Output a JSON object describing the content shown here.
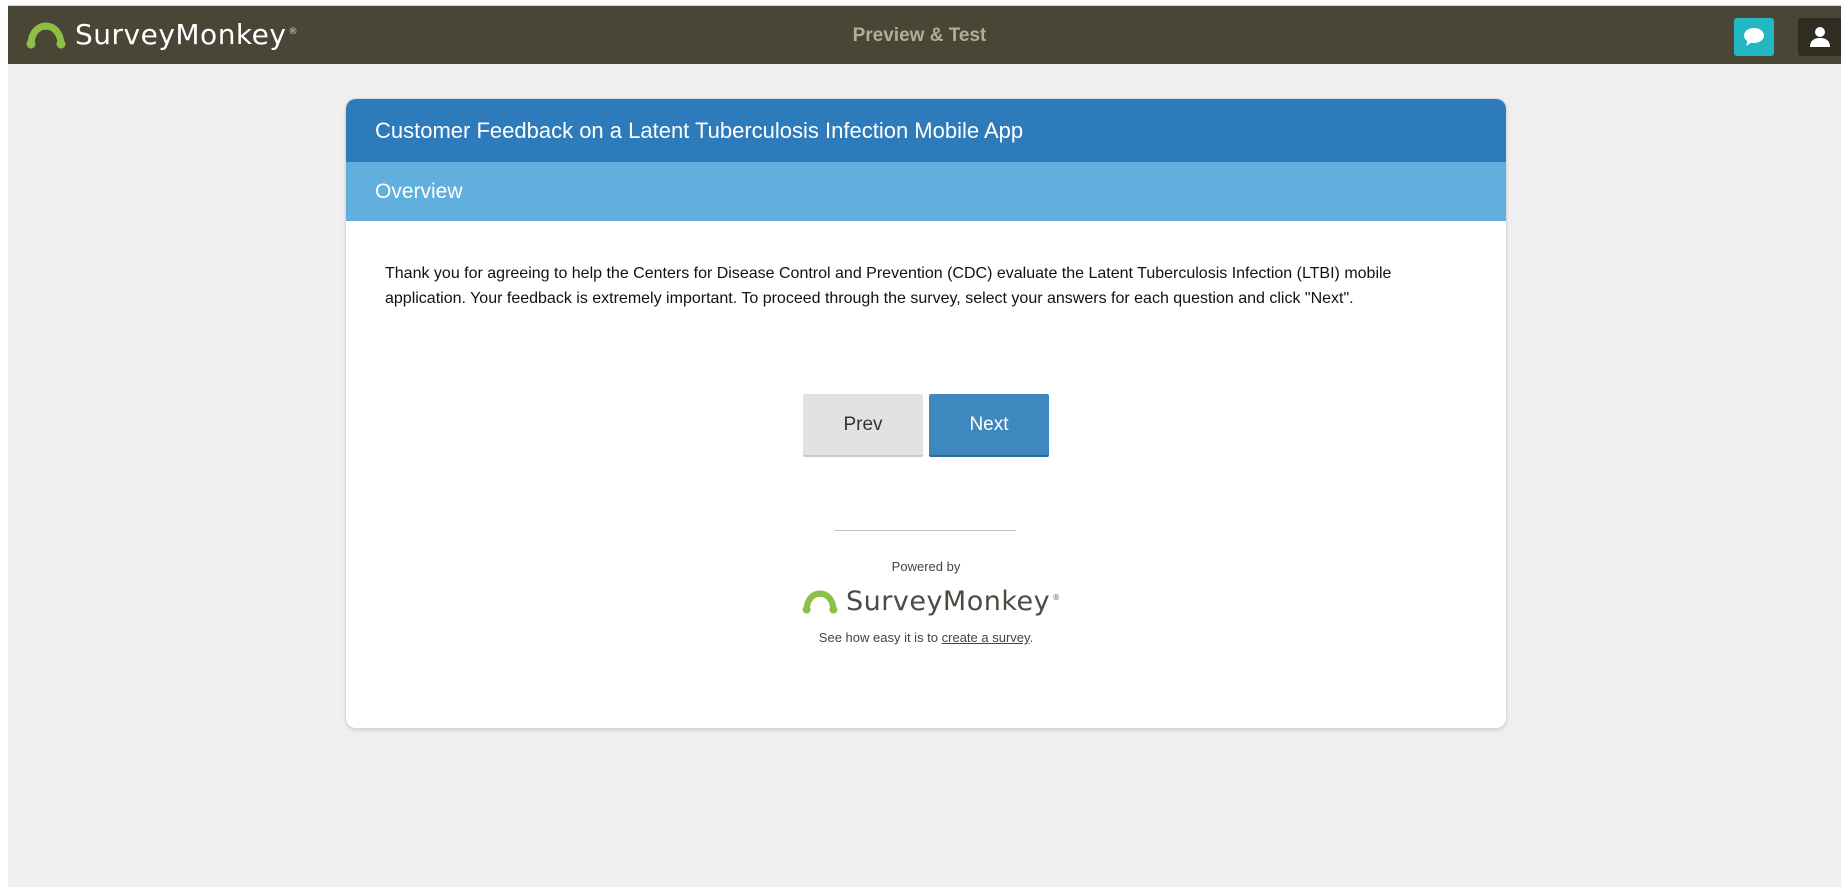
{
  "app": {
    "brand_name": "SurveyMonkey",
    "brand_mark": "®",
    "mode_title": "Preview & Test",
    "icons": {
      "logo": "surveymonkey-logo-icon",
      "chat": "chat-bubble-icon",
      "user": "user-icon"
    },
    "colors": {
      "topbar": "#4a4636",
      "chat_button": "#23b7c4",
      "logo_green": "#8cbf44"
    }
  },
  "survey": {
    "title": "Customer Feedback on a Latent Tuberculosis Infection Mobile App",
    "page_title": "Overview",
    "intro_text": "Thank you for agreeing to help the Centers for Disease Control and Prevention (CDC) evaluate the Latent Tuberculosis Infection (LTBI) mobile application. Your feedback is extremely important. To proceed through the survey, select your answers for each question and click \"Next\".",
    "prev_label": "Prev",
    "next_label": "Next",
    "colors": {
      "title_bar": "#2d7bba",
      "page_bar": "#60afdc",
      "next_button": "#3e88bf"
    }
  },
  "footer": {
    "powered_by": "Powered by",
    "brand_name": "SurveyMonkey",
    "brand_mark": "®",
    "see_text": "See how easy it is to ",
    "create_link": "create a survey",
    "period": "."
  }
}
